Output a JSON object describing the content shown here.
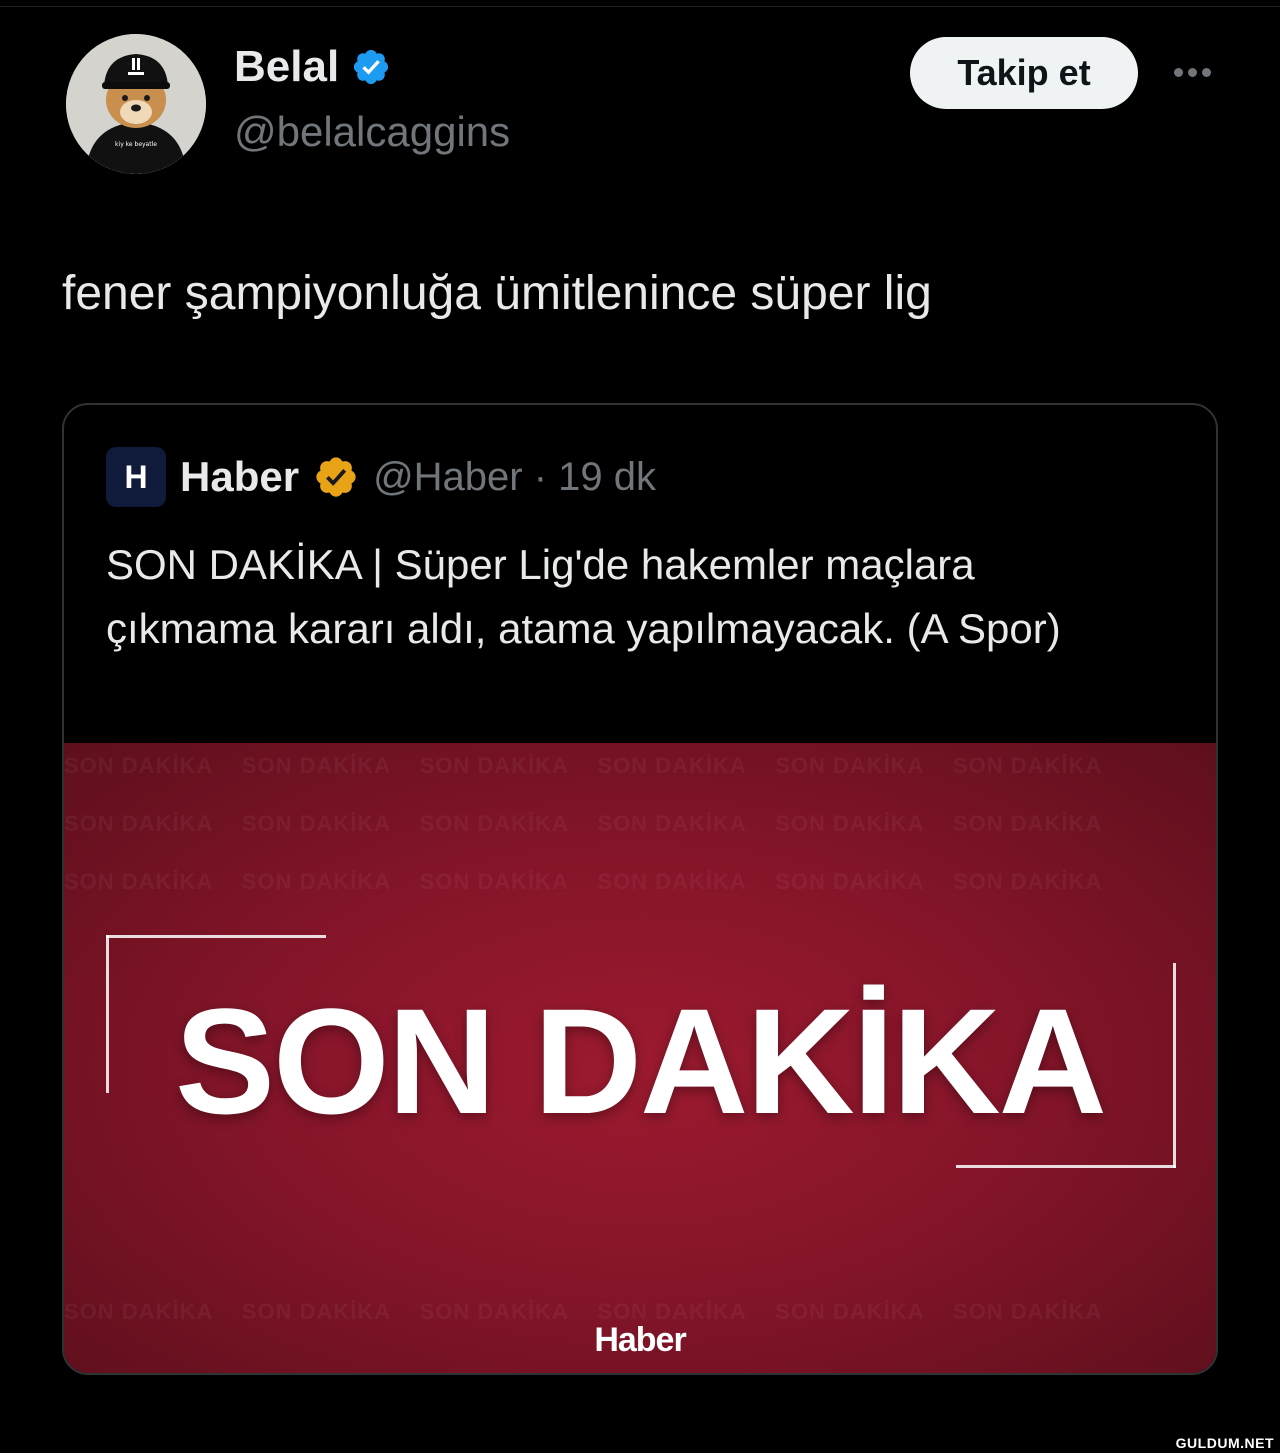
{
  "author": {
    "name": "Belal",
    "handle": "@belalcaggins",
    "avatar_text": "kiy ke beyatle",
    "verified_color": "#1d9bf0"
  },
  "actions": {
    "follow_label": "Takip et",
    "more_icon": "more-horizontal-icon"
  },
  "tweet": {
    "text": "fener şampiyonluğa ümitlenince süper lig"
  },
  "quote": {
    "logo_letter": "H",
    "name": "Haber",
    "verified_color": "#e8a317",
    "handle_time": "@Haber · 19 dk",
    "text": "SON DAKİKA | Süper Lig'de hakemler maçlara çıkmama kararı aldı, atama yapılmayacak. (A Spor)",
    "image": {
      "headline": "SON DAKİKA",
      "brand": "Haber",
      "pattern_text": "SON DAKİKA",
      "background_color": "#8f172b"
    }
  },
  "watermark": "GULDUM.NET"
}
